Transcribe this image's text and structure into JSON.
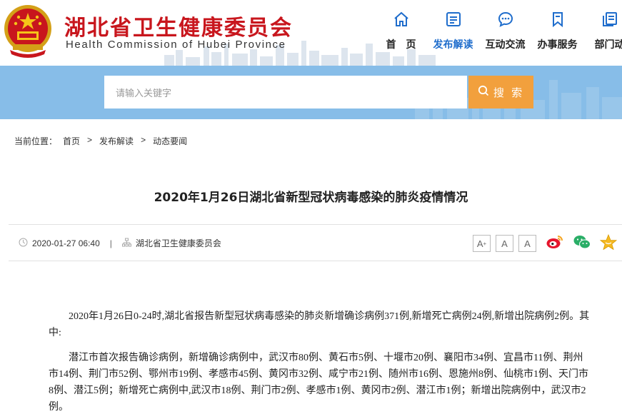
{
  "header": {
    "title": "湖北省卫生健康委员会",
    "subtitle": "Health Commission of Hubei Province"
  },
  "nav": {
    "items": [
      {
        "label": "首　页",
        "icon": "home-icon"
      },
      {
        "label": "发布解读",
        "icon": "document-icon",
        "active": true
      },
      {
        "label": "互动交流",
        "icon": "chat-icon"
      },
      {
        "label": "办事服务",
        "icon": "bookmark-icon"
      },
      {
        "label": "部门动",
        "icon": "pages-icon"
      }
    ]
  },
  "search": {
    "placeholder": "请输入关键字",
    "button_label": "搜 索"
  },
  "breadcrumb": {
    "prefix": "当前位置：",
    "items": [
      "首页",
      "发布解读",
      "动态要闻"
    ],
    "separator": ">"
  },
  "article": {
    "title": "2020年1月26日湖北省新型冠状病毒感染的肺炎疫情情况",
    "date": "2020-01-27 06:40",
    "source": "湖北省卫生健康委员会",
    "meta_separator": "|",
    "paragraphs": [
      "2020年1月26日0-24时,湖北省报告新型冠状病毒感染的肺炎新增确诊病例371例,新增死亡病例24例,新增出院病例2例。其中:",
      "潜江市首次报告确诊病例，新增确诊病例中，武汉市80例、黄石市5例、十堰市20例、襄阳市34例、宜昌市11例、荆州市14例、荆门市52例、鄂州市19例、孝感市45例、黄冈市32例、咸宁市21例、随州市16例、恩施州8例、仙桃市1例、天门市8例、潜江5例；新增死亡病例中,武汉市18例、荆门市2例、孝感市1例、黄冈市2例、潜江市1例；新增出院病例中，武汉市2例。"
    ]
  },
  "font_size_buttons": {
    "larger": "A",
    "medium": "A",
    "smaller": "A",
    "larger_sup": "+"
  },
  "colors": {
    "brand_red": "#c8161d",
    "nav_active": "#1f6dcc",
    "search_band": "#87bde8",
    "search_button": "#f2a03d"
  }
}
